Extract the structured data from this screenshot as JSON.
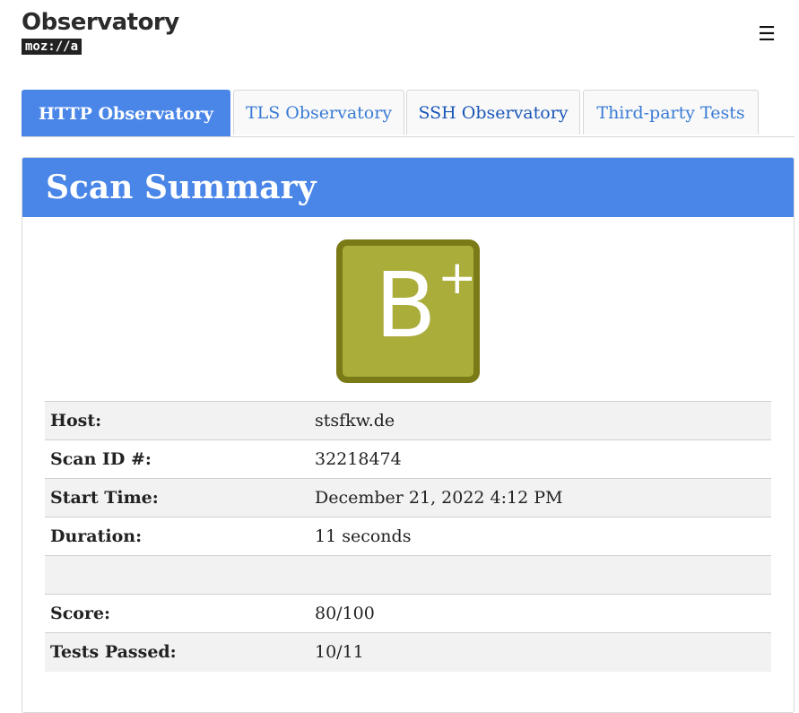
{
  "header": {
    "title": "Observatory",
    "logo_text": "moz://a",
    "menu_glyph": "☰"
  },
  "tabs": [
    {
      "label": "HTTP Observatory",
      "active": true
    },
    {
      "label": "TLS Observatory",
      "active": false
    },
    {
      "label": "SSH Observatory",
      "active": false
    },
    {
      "label": "Third-party Tests",
      "active": false
    }
  ],
  "summary": {
    "heading": "Scan Summary",
    "grade": {
      "letter": "B",
      "modifier": "+",
      "color": "#aaad3a",
      "border_color": "#7a7a16"
    },
    "rows": {
      "host": {
        "label": "Host:",
        "value": "stsfkw.de"
      },
      "scan_id": {
        "label": "Scan ID #:",
        "value": "32218474"
      },
      "start_time": {
        "label": "Start Time:",
        "value": "December 21, 2022 4:12 PM"
      },
      "duration": {
        "label": "Duration:",
        "value": "11 seconds"
      },
      "score": {
        "label": "Score:",
        "value": "80/100"
      },
      "tests_passed": {
        "label": "Tests Passed:",
        "value": "10/11"
      }
    }
  },
  "colors": {
    "accent": "#4a86e8",
    "tab_text": "#3a7bd5"
  }
}
